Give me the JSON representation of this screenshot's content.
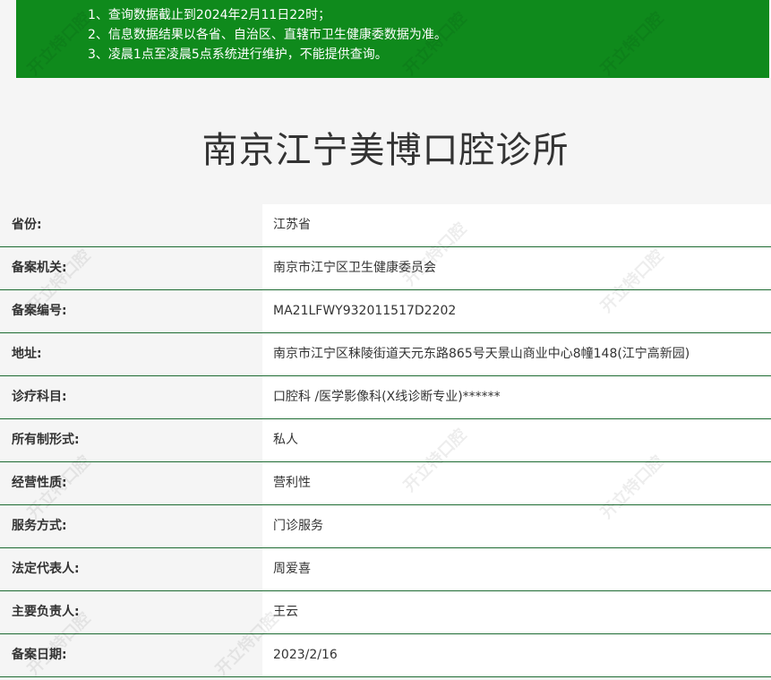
{
  "notice": {
    "lines": [
      "1、查询数据截止到2024年2月11日22时；",
      "2、信息数据结果以各省、自治区、直辖市卫生健康委数据为准。",
      "3、凌晨1点至凌晨5点系统进行维护，不能提供查询。"
    ]
  },
  "page_title": "南京江宁美博口腔诊所",
  "records": [
    {
      "label": "省份:",
      "value": "江苏省"
    },
    {
      "label": "备案机关:",
      "value": "南京市江宁区卫生健康委员会"
    },
    {
      "label": "备案编号:",
      "value": "MA21LFWY932011517D2202"
    },
    {
      "label": "地址:",
      "value": "南京市江宁区秣陵街道天元东路865号天景山商业中心8幢148(江宁高新园)"
    },
    {
      "label": "诊疗科目:",
      "value": "口腔科 /医学影像科(X线诊断专业)******"
    },
    {
      "label": "所有制形式:",
      "value": "私人"
    },
    {
      "label": "经营性质:",
      "value": "营利性"
    },
    {
      "label": "服务方式:",
      "value": "门诊服务"
    },
    {
      "label": "法定代表人:",
      "value": "周爱喜"
    },
    {
      "label": "主要负责人:",
      "value": "王云"
    },
    {
      "label": "备案日期:",
      "value": "2023/2/16"
    }
  ],
  "watermark": "开立特口腔",
  "colors": {
    "notice_bg": "#0f8a1c",
    "row_border": "#1d6b32"
  }
}
